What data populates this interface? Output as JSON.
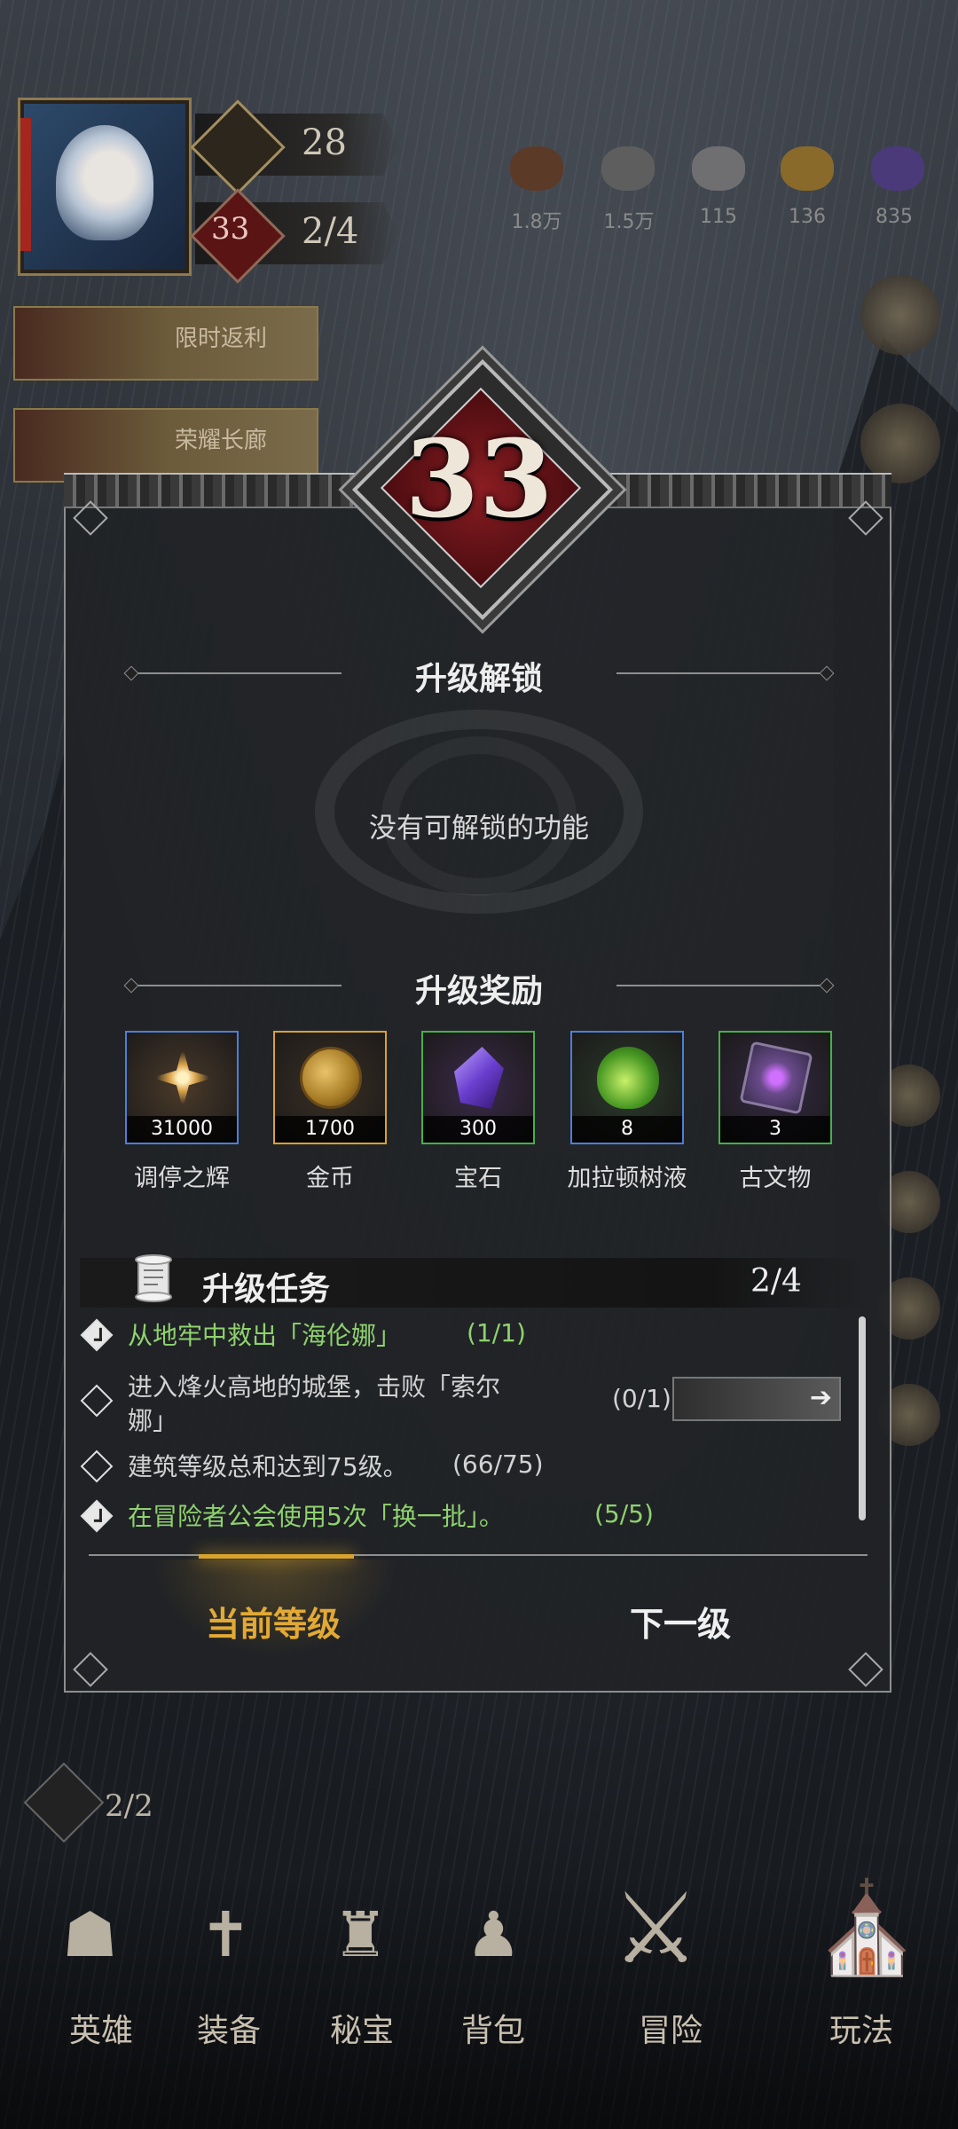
{
  "hud": {
    "stat1_value": "28",
    "stat2_value": "2/4",
    "level_badge_small": "33"
  },
  "resources": [
    "1.8万",
    "1.5万",
    "115",
    "136",
    "835"
  ],
  "side_banners": [
    "限时返利",
    "荣耀长廊"
  ],
  "modal": {
    "level": "33",
    "unlock_title": "升级解锁",
    "unlock_empty": "没有可解锁的功能",
    "reward_title": "升级奖励",
    "rewards": [
      {
        "name": "调停之辉",
        "count": "31000",
        "border": "#4d7fd6",
        "icon": "radiance-icon"
      },
      {
        "name": "金币",
        "count": "1700",
        "border": "#d8a32c",
        "icon": "gold-coin-icon"
      },
      {
        "name": "宝石",
        "count": "300",
        "border": "#46b04a",
        "icon": "gem-icon"
      },
      {
        "name": "加拉顿树液",
        "count": "8",
        "border": "#4d7fd6",
        "icon": "potion-icon"
      },
      {
        "name": "古文物",
        "count": "3",
        "border": "#46b04a",
        "icon": "relic-icon"
      }
    ],
    "task_section": {
      "title": "升级任务",
      "count": "2/4",
      "tasks": [
        {
          "text": "从地牢中救出「海伦娜」",
          "progress": "(1/1)",
          "done": true
        },
        {
          "text_line1": "进入烽火高地的城堡，击败「索尔",
          "text_line2": "娜」",
          "progress": "(0/1)",
          "done": false
        },
        {
          "text": "建筑等级总和达到75级。",
          "progress": "(66/75)",
          "done": false
        },
        {
          "text": "在冒险者公会使用5次「换一批」。",
          "progress": "(5/5)",
          "done": true
        }
      ]
    },
    "tabs": {
      "current": "当前等级",
      "next": "下一级"
    }
  },
  "bottom_nav": [
    "英雄",
    "装备",
    "秘宝",
    "背包",
    "冒险",
    "玩法"
  ],
  "side_counter": "2/2",
  "colors": {
    "accent_gold": "#d8a32c",
    "done_green": "#8ed26e",
    "badge_red": "#8a1d22"
  }
}
